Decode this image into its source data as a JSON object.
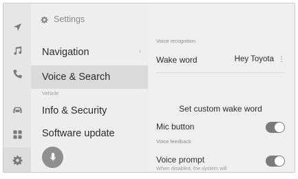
{
  "rail": {
    "items": [
      {
        "icon": "navigation-arrow-icon"
      },
      {
        "icon": "music-icon"
      },
      {
        "icon": "phone-icon"
      },
      {
        "icon": "car-icon"
      },
      {
        "icon": "apps-grid-icon"
      },
      {
        "icon": "settings-gear-icon",
        "active": true
      }
    ]
  },
  "menu": {
    "header": "Settings",
    "items": [
      {
        "label": "Navigation",
        "chevron": "›"
      },
      {
        "label": "Voice & Search",
        "active": true
      },
      {
        "label": "Info & Security"
      },
      {
        "label": "Software update"
      }
    ],
    "section_vehicle": "Vehicle"
  },
  "detail": {
    "voice_recognition_section": "Voice recognition",
    "wake_word_label": "Wake word",
    "wake_word_value": "Hey Toyota",
    "wake_word_menu": "⋮",
    "custom_wake_word": "Set custom wake word",
    "mic_button_label": "Mic button",
    "mic_button_on": true,
    "voice_feedback_section": "Voice feedback",
    "voice_prompt_label": "Voice prompt",
    "voice_prompt_on": true,
    "voice_prompt_note": "When disabled, the system will"
  }
}
